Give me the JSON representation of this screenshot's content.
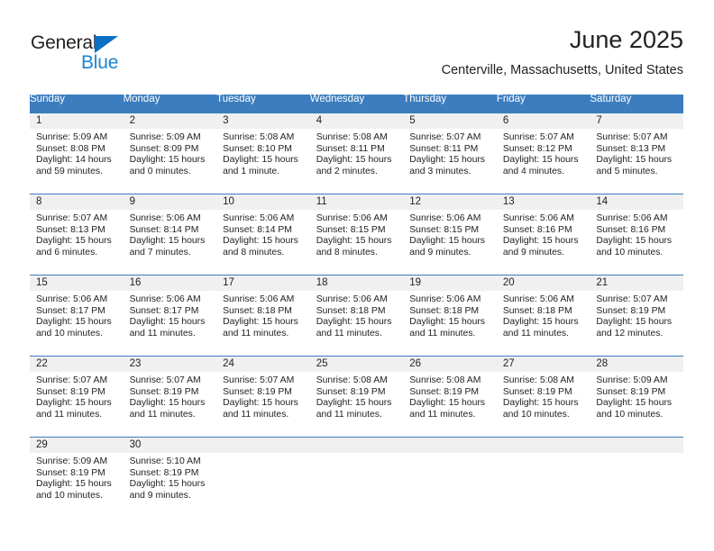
{
  "brand": {
    "name_dark": "General",
    "name_light": "Blue",
    "triangle_color": "#0b6fc4",
    "light_text_color": "#1b84d2"
  },
  "header": {
    "title": "June 2025",
    "location": "Centerville, Massachusetts, United States"
  },
  "theme": {
    "header_blue": "#3b7dbf",
    "daynum_strip": "#f0f0f0",
    "text": "#222222"
  },
  "weekday_headers": [
    "Sunday",
    "Monday",
    "Tuesday",
    "Wednesday",
    "Thursday",
    "Friday",
    "Saturday"
  ],
  "weeks": [
    [
      {
        "day": "1",
        "sunrise": "Sunrise: 5:09 AM",
        "sunset": "Sunset: 8:08 PM",
        "daylight_1": "Daylight: 14 hours",
        "daylight_2": "and 59 minutes."
      },
      {
        "day": "2",
        "sunrise": "Sunrise: 5:09 AM",
        "sunset": "Sunset: 8:09 PM",
        "daylight_1": "Daylight: 15 hours",
        "daylight_2": "and 0 minutes."
      },
      {
        "day": "3",
        "sunrise": "Sunrise: 5:08 AM",
        "sunset": "Sunset: 8:10 PM",
        "daylight_1": "Daylight: 15 hours",
        "daylight_2": "and 1 minute."
      },
      {
        "day": "4",
        "sunrise": "Sunrise: 5:08 AM",
        "sunset": "Sunset: 8:11 PM",
        "daylight_1": "Daylight: 15 hours",
        "daylight_2": "and 2 minutes."
      },
      {
        "day": "5",
        "sunrise": "Sunrise: 5:07 AM",
        "sunset": "Sunset: 8:11 PM",
        "daylight_1": "Daylight: 15 hours",
        "daylight_2": "and 3 minutes."
      },
      {
        "day": "6",
        "sunrise": "Sunrise: 5:07 AM",
        "sunset": "Sunset: 8:12 PM",
        "daylight_1": "Daylight: 15 hours",
        "daylight_2": "and 4 minutes."
      },
      {
        "day": "7",
        "sunrise": "Sunrise: 5:07 AM",
        "sunset": "Sunset: 8:13 PM",
        "daylight_1": "Daylight: 15 hours",
        "daylight_2": "and 5 minutes."
      }
    ],
    [
      {
        "day": "8",
        "sunrise": "Sunrise: 5:07 AM",
        "sunset": "Sunset: 8:13 PM",
        "daylight_1": "Daylight: 15 hours",
        "daylight_2": "and 6 minutes."
      },
      {
        "day": "9",
        "sunrise": "Sunrise: 5:06 AM",
        "sunset": "Sunset: 8:14 PM",
        "daylight_1": "Daylight: 15 hours",
        "daylight_2": "and 7 minutes."
      },
      {
        "day": "10",
        "sunrise": "Sunrise: 5:06 AM",
        "sunset": "Sunset: 8:14 PM",
        "daylight_1": "Daylight: 15 hours",
        "daylight_2": "and 8 minutes."
      },
      {
        "day": "11",
        "sunrise": "Sunrise: 5:06 AM",
        "sunset": "Sunset: 8:15 PM",
        "daylight_1": "Daylight: 15 hours",
        "daylight_2": "and 8 minutes."
      },
      {
        "day": "12",
        "sunrise": "Sunrise: 5:06 AM",
        "sunset": "Sunset: 8:15 PM",
        "daylight_1": "Daylight: 15 hours",
        "daylight_2": "and 9 minutes."
      },
      {
        "day": "13",
        "sunrise": "Sunrise: 5:06 AM",
        "sunset": "Sunset: 8:16 PM",
        "daylight_1": "Daylight: 15 hours",
        "daylight_2": "and 9 minutes."
      },
      {
        "day": "14",
        "sunrise": "Sunrise: 5:06 AM",
        "sunset": "Sunset: 8:16 PM",
        "daylight_1": "Daylight: 15 hours",
        "daylight_2": "and 10 minutes."
      }
    ],
    [
      {
        "day": "15",
        "sunrise": "Sunrise: 5:06 AM",
        "sunset": "Sunset: 8:17 PM",
        "daylight_1": "Daylight: 15 hours",
        "daylight_2": "and 10 minutes."
      },
      {
        "day": "16",
        "sunrise": "Sunrise: 5:06 AM",
        "sunset": "Sunset: 8:17 PM",
        "daylight_1": "Daylight: 15 hours",
        "daylight_2": "and 11 minutes."
      },
      {
        "day": "17",
        "sunrise": "Sunrise: 5:06 AM",
        "sunset": "Sunset: 8:18 PM",
        "daylight_1": "Daylight: 15 hours",
        "daylight_2": "and 11 minutes."
      },
      {
        "day": "18",
        "sunrise": "Sunrise: 5:06 AM",
        "sunset": "Sunset: 8:18 PM",
        "daylight_1": "Daylight: 15 hours",
        "daylight_2": "and 11 minutes."
      },
      {
        "day": "19",
        "sunrise": "Sunrise: 5:06 AM",
        "sunset": "Sunset: 8:18 PM",
        "daylight_1": "Daylight: 15 hours",
        "daylight_2": "and 11 minutes."
      },
      {
        "day": "20",
        "sunrise": "Sunrise: 5:06 AM",
        "sunset": "Sunset: 8:18 PM",
        "daylight_1": "Daylight: 15 hours",
        "daylight_2": "and 11 minutes."
      },
      {
        "day": "21",
        "sunrise": "Sunrise: 5:07 AM",
        "sunset": "Sunset: 8:19 PM",
        "daylight_1": "Daylight: 15 hours",
        "daylight_2": "and 12 minutes."
      }
    ],
    [
      {
        "day": "22",
        "sunrise": "Sunrise: 5:07 AM",
        "sunset": "Sunset: 8:19 PM",
        "daylight_1": "Daylight: 15 hours",
        "daylight_2": "and 11 minutes."
      },
      {
        "day": "23",
        "sunrise": "Sunrise: 5:07 AM",
        "sunset": "Sunset: 8:19 PM",
        "daylight_1": "Daylight: 15 hours",
        "daylight_2": "and 11 minutes."
      },
      {
        "day": "24",
        "sunrise": "Sunrise: 5:07 AM",
        "sunset": "Sunset: 8:19 PM",
        "daylight_1": "Daylight: 15 hours",
        "daylight_2": "and 11 minutes."
      },
      {
        "day": "25",
        "sunrise": "Sunrise: 5:08 AM",
        "sunset": "Sunset: 8:19 PM",
        "daylight_1": "Daylight: 15 hours",
        "daylight_2": "and 11 minutes."
      },
      {
        "day": "26",
        "sunrise": "Sunrise: 5:08 AM",
        "sunset": "Sunset: 8:19 PM",
        "daylight_1": "Daylight: 15 hours",
        "daylight_2": "and 11 minutes."
      },
      {
        "day": "27",
        "sunrise": "Sunrise: 5:08 AM",
        "sunset": "Sunset: 8:19 PM",
        "daylight_1": "Daylight: 15 hours",
        "daylight_2": "and 10 minutes."
      },
      {
        "day": "28",
        "sunrise": "Sunrise: 5:09 AM",
        "sunset": "Sunset: 8:19 PM",
        "daylight_1": "Daylight: 15 hours",
        "daylight_2": "and 10 minutes."
      }
    ],
    [
      {
        "day": "29",
        "sunrise": "Sunrise: 5:09 AM",
        "sunset": "Sunset: 8:19 PM",
        "daylight_1": "Daylight: 15 hours",
        "daylight_2": "and 10 minutes."
      },
      {
        "day": "30",
        "sunrise": "Sunrise: 5:10 AM",
        "sunset": "Sunset: 8:19 PM",
        "daylight_1": "Daylight: 15 hours",
        "daylight_2": "and 9 minutes."
      },
      {
        "day": "",
        "sunrise": "",
        "sunset": "",
        "daylight_1": "",
        "daylight_2": ""
      },
      {
        "day": "",
        "sunrise": "",
        "sunset": "",
        "daylight_1": "",
        "daylight_2": ""
      },
      {
        "day": "",
        "sunrise": "",
        "sunset": "",
        "daylight_1": "",
        "daylight_2": ""
      },
      {
        "day": "",
        "sunrise": "",
        "sunset": "",
        "daylight_1": "",
        "daylight_2": ""
      },
      {
        "day": "",
        "sunrise": "",
        "sunset": "",
        "daylight_1": "",
        "daylight_2": ""
      }
    ]
  ]
}
